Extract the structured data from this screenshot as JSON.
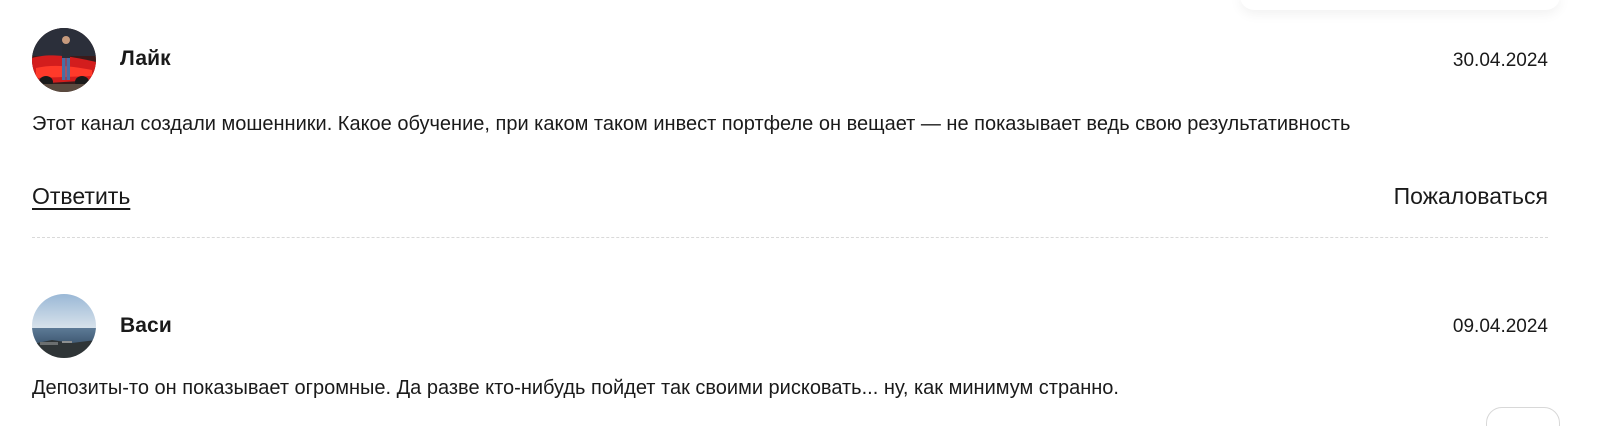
{
  "comments": [
    {
      "author": "Лайк",
      "date": "30.04.2024",
      "text": "Этот канал создали мошенники. Какое обучение, при каком таком инвест портфеле он вещает — не показывает ведь свою результативность",
      "reply_label": "Ответить",
      "report_label": "Пожаловаться"
    },
    {
      "author": "Васи",
      "date": "09.04.2024",
      "text": "Депозиты-то он показывает огромные. Да разве кто-нибудь пойдет так своими рисковать... ну, как минимум странно."
    }
  ]
}
